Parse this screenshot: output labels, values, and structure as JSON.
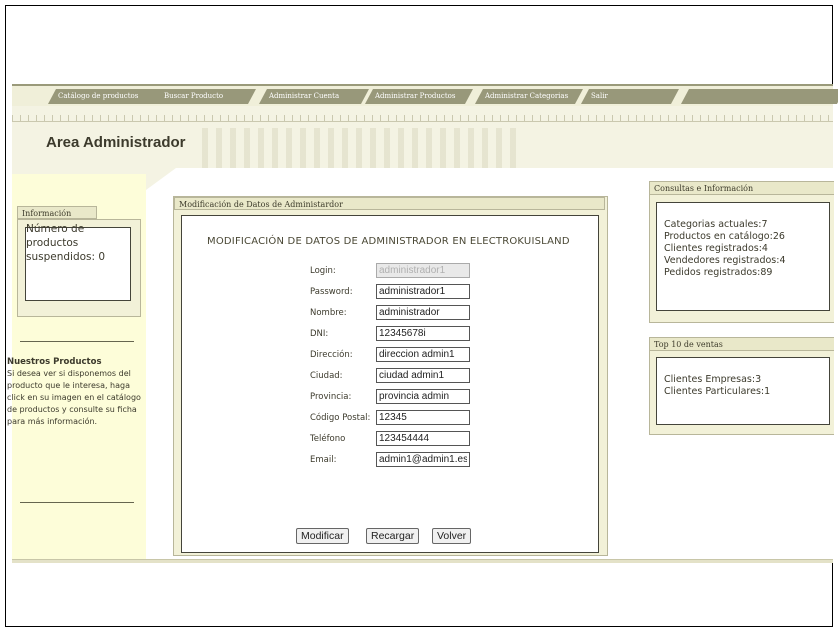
{
  "nav": {
    "tabs": [
      "Catálogo de productos",
      "Buscar Producto",
      "Administrar Cuenta",
      "Administrar Productos",
      "Administrar Categorias",
      "Salir",
      ""
    ]
  },
  "header": {
    "title": "Area Administrador",
    "background_color": "#f4f3e3",
    "nav_tab_color": "#98987a"
  },
  "sidebar": {
    "info_title": "Información",
    "info_text": "Número de productos suspendidos: 0",
    "products_title": "Nuestros Productos",
    "products_text": "Si desea ver si disponemos del producto que le interesa, haga click en su imagen en el catálogo de productos y consulte su ficha para más información."
  },
  "main": {
    "box_title": "Modificación de Datos de Administardor",
    "form_title": "MODIFICACIÓN DE DATOS DE ADMINISTRADOR EN ELECTROKUISLAND",
    "fields": [
      {
        "label": "Login:",
        "value": "administrador1",
        "disabled": true
      },
      {
        "label": "Password:",
        "value": "administrador1"
      },
      {
        "label": "Nombre:",
        "value": "administrador"
      },
      {
        "label": "DNI:",
        "value": "12345678i"
      },
      {
        "label": "Dirección:",
        "value": "direccion admin1"
      },
      {
        "label": "Ciudad:",
        "value": "ciudad admin1"
      },
      {
        "label": "Provincia:",
        "value": "provincia admin"
      },
      {
        "label": "Código Postal:",
        "value": "12345"
      },
      {
        "label": "Teléfono",
        "value": "123454444"
      },
      {
        "label": "Email:",
        "value": "admin1@admin1.es"
      }
    ],
    "buttons": {
      "modificar": "Modificar",
      "recargar": "Recargar",
      "volver": "Volver"
    }
  },
  "right": {
    "consultas_title": "Consultas e Información",
    "consultas_items": [
      "Categorias actuales:7",
      "Productos en catálogo:26",
      "Clientes registrados:4",
      "Vendedores registrados:4",
      "Pedidos registrados:89"
    ],
    "top10_title": "Top 10 de ventas",
    "top10_items": [
      "Clientes Empresas:3",
      "Clientes Particulares:1"
    ]
  }
}
